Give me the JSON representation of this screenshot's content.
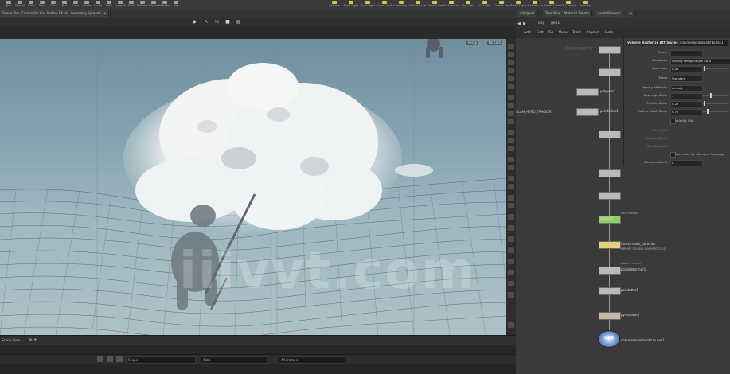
{
  "shelf": {
    "tools": [
      "Box",
      "Sphere",
      "Tube",
      "Torus",
      "Grid",
      "Null",
      "Line",
      "Circle",
      "Curve",
      "Path",
      "Spray Paint",
      "Font",
      "Platonic Solids",
      "L-System",
      "Metaball",
      "File"
    ],
    "right_tools": [
      "Camera",
      "Point Light",
      "Spot Light",
      "Area Light",
      "Geometry Light",
      "Volume Light",
      "Distant Light",
      "Environment Light",
      "Sky Light",
      "GI Light",
      "Caustic Light",
      "Portal Light",
      "Ambient Light",
      "Stereo Camera",
      "VR Camera",
      "Switcher"
    ]
  },
  "viewport": {
    "tabs": [
      "Scene View",
      "Composite View",
      "Motion FX View",
      "Geometry Spreadsheet"
    ],
    "persp_label": "Persp",
    "camera_label": "No cam",
    "watermark": "iiivvt.com",
    "bottom_tab": "Scene View"
  },
  "timeline": {
    "field_1": "Scope",
    "field_2": "Auto",
    "field_3": "All Frames"
  },
  "network": {
    "tabs": [
      "/obj/geo1",
      "Tree View",
      "Material Palette",
      "Asset Browser"
    ],
    "path_obj": "obj",
    "path_geo": "geo1",
    "menu": [
      "Add",
      "Edit",
      "Go",
      "View",
      "Tools",
      "Layout",
      "Help"
    ],
    "geo_label": "Geometry",
    "side_label": "SLAM_HERO_TRACKER",
    "nodes": [
      {
        "label": "",
        "sub": ""
      },
      {
        "label": "",
        "sub": ""
      },
      {
        "label": "polywire1",
        "sub": ""
      },
      {
        "label": "pointrelax1",
        "sub": ""
      },
      {
        "label": "",
        "sub": ""
      },
      {
        "label": "",
        "sub": ""
      },
      {
        "label": "",
        "sub": ""
      },
      {
        "label": "popnet2",
        "sub": "DOP network"
      },
      {
        "label": "blend2",
        "sub": ""
      },
      {
        "label": "facetstream_particles",
        "sub": "IMPORT SOURCE SIM PARTICLES"
      },
      {
        "label": "pointdeformer1",
        "sub": "Make it render"
      },
      {
        "label": "pointattrs1",
        "sub": ""
      },
      {
        "label": "pyrosolver1",
        "sub": ""
      },
      {
        "label": "volumerasterizeattributes1",
        "sub": ""
      }
    ]
  },
  "params": {
    "title": "Volume Rasterize Attributes",
    "node_name": "volumerasterizeattributes1",
    "rows": [
      {
        "label": "Group",
        "value": ""
      },
      {
        "label": "Attributes",
        "value": "density temperature Cd A"
      },
      {
        "label": "Voxel Size",
        "value": "0.05"
      },
      {
        "label": "Mode",
        "value": "Standard"
      },
      {
        "label": "Density Attribute",
        "value": "density"
      },
      {
        "label": "Coverage Scale",
        "value": "1"
      },
      {
        "label": "Particle Scale",
        "value": "0.22"
      },
      {
        "label": "Radius Cutoff Scale",
        "value": "0.75"
      },
      {
        "label": "Velocity Blur",
        "value": ""
      },
      {
        "label": "Blur Style",
        "value": ""
      },
      {
        "label": "Velocity Scale",
        "value": ""
      },
      {
        "label": "Blur Samples",
        "value": ""
      },
      {
        "label": "Normalize by Clamped Coverage",
        "value": ""
      },
      {
        "label": "Attribute Blend",
        "value": "0"
      }
    ]
  }
}
